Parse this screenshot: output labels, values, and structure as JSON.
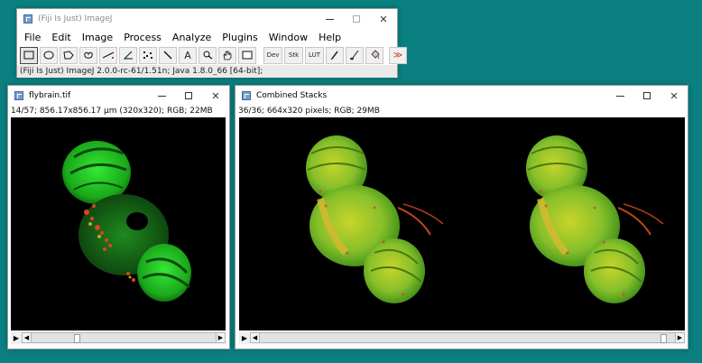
{
  "main": {
    "title": "(Fiji Is Just) ImageJ",
    "menus": [
      "File",
      "Edit",
      "Image",
      "Process",
      "Analyze",
      "Plugins",
      "Window",
      "Help"
    ],
    "tool_labels": {
      "dev": "Dev",
      "stk": "Stk",
      "lut": "LUT",
      "text": "A",
      "more": "≫"
    },
    "status": "(Fiji Is Just) ImageJ 2.0.0-rc-61/1.51n; Java 1.8.0_66 [64-bit];"
  },
  "flybrain": {
    "title": "flybrain.tif",
    "info": "14/57; 856.17x856.17 µm (320x320); RGB; 22MB",
    "slice_position": 0.24
  },
  "combined": {
    "title": "Combined Stacks",
    "info": "36/36; 664x320 pixels; RGB; 29MB",
    "slice_position": 0.98
  },
  "colors": {
    "desktop": "#0a8080",
    "brain_green": "#2fd62f",
    "brain_yellow": "#b8d22a",
    "brain_red": "#e0441a"
  },
  "icons": {
    "play": "play-icon",
    "left": "scroll-left-icon",
    "right": "scroll-right-icon"
  }
}
